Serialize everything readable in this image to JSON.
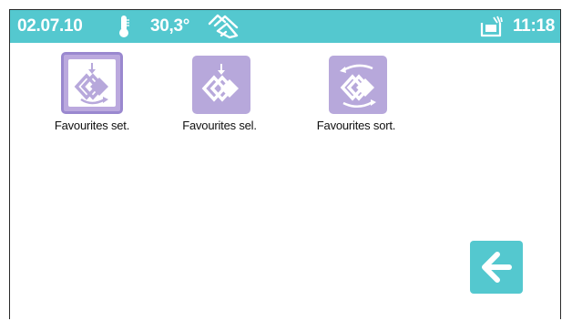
{
  "status_bar": {
    "date": "02.07.10",
    "temperature": "30,3°",
    "time": "11:18",
    "icons": [
      "thermometer-icon",
      "hand-touch-icon",
      "tray-icon"
    ],
    "background_color": "#54c8cf"
  },
  "tiles": [
    {
      "label": "Favourites set.",
      "icon": "favourites-set-icon",
      "selected": true
    },
    {
      "label": "Favourites sel.",
      "icon": "favourites-select-icon",
      "selected": false
    },
    {
      "label": "Favourites sort.",
      "icon": "favourites-sort-icon",
      "selected": false
    }
  ],
  "back_button": {
    "icon": "arrow-left-icon"
  },
  "colors": {
    "accent": "#54c8cf",
    "tile": "#b7a8db",
    "tile_selected_border": "#9a88cf"
  }
}
